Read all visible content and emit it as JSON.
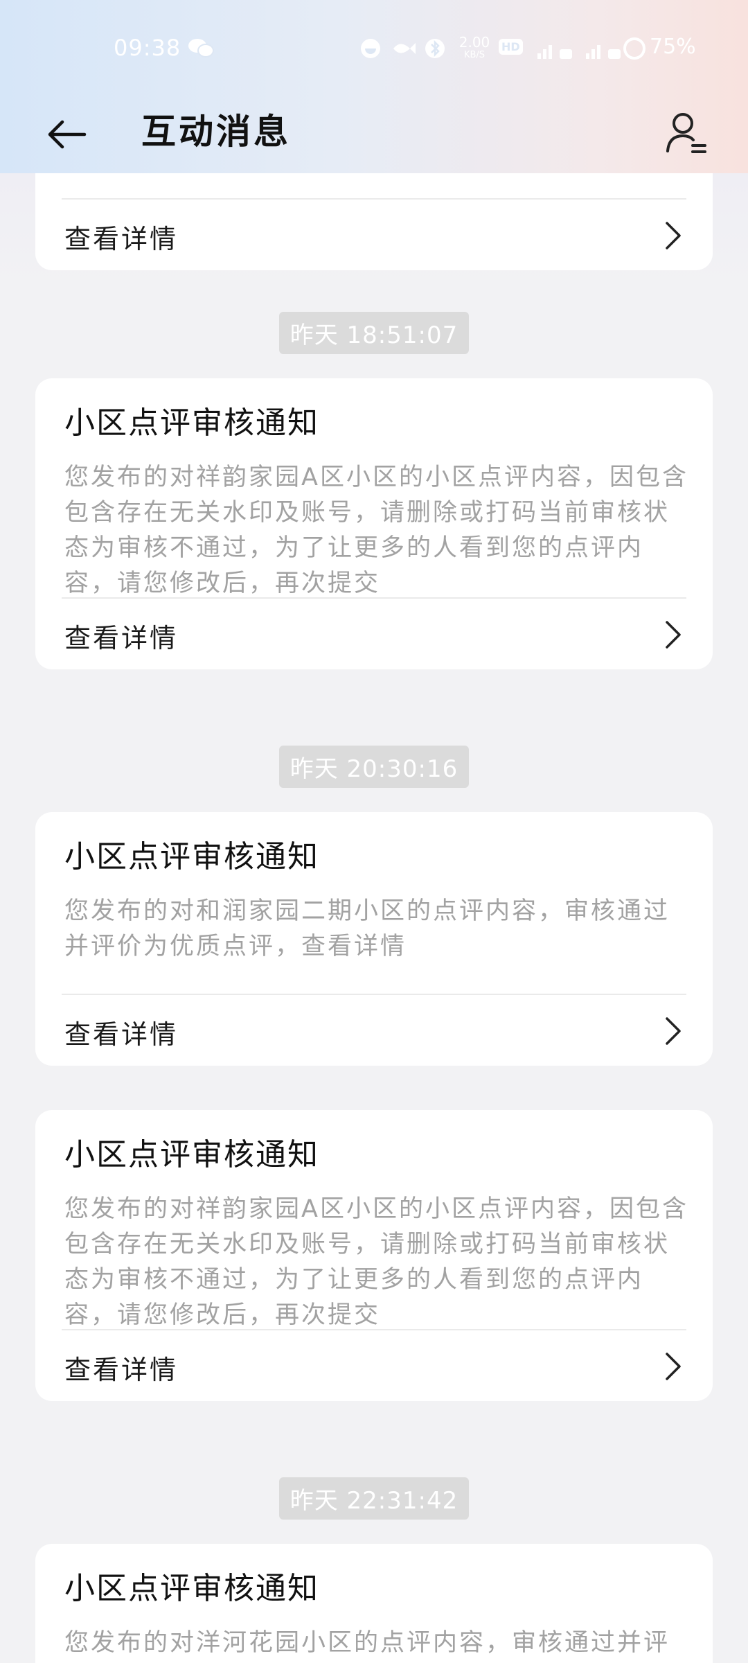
{
  "status_bar": {
    "time": "09:38",
    "net_speed_value": "2.00",
    "net_speed_unit": "KB/S",
    "hd_label": "HD",
    "battery_percent": "75%",
    "icons": [
      "wechat-icon",
      "dnd-icon",
      "fish-icon",
      "bluetooth-icon",
      "signal-icon",
      "battery-icon"
    ]
  },
  "header": {
    "title": "互动消息",
    "back_icon": "arrow-left-icon",
    "profile_icon": "user-list-icon"
  },
  "messages": [
    {
      "partial": true,
      "action_label": "查看详情"
    },
    {
      "timestamp": "昨天 18:51:07",
      "title": "小区点评审核通知",
      "body": "您发布的对祥韵家园A区小区的小区点评内容，因包含包含存在无关水印及账号，请删除或打码当前审核状态为审核不通过，为了让更多的人看到您的点评内容，请您修改后，再次提交",
      "action_label": "查看详情"
    },
    {
      "timestamp": "昨天 20:30:16",
      "title": "小区点评审核通知",
      "body": "您发布的对和润家园二期小区的点评内容，审核通过并评价为优质点评，查看详情",
      "action_label": "查看详情"
    },
    {
      "title": "小区点评审核通知",
      "body": "您发布的对祥韵家园A区小区的小区点评内容，因包含包含存在无关水印及账号，请删除或打码当前审核状态为审核不通过，为了让更多的人看到您的点评内容，请您修改后，再次提交",
      "action_label": "查看详情"
    },
    {
      "timestamp": "昨天 22:31:42",
      "title": "小区点评审核通知",
      "body": "您发布的对洋河花园小区的点评内容，审核通过并评"
    }
  ],
  "colors": {
    "background": "#f2f2f4",
    "card": "#ffffff",
    "body_text": "#a2a2a2",
    "timestamp_bg": "#dbdbdb"
  }
}
